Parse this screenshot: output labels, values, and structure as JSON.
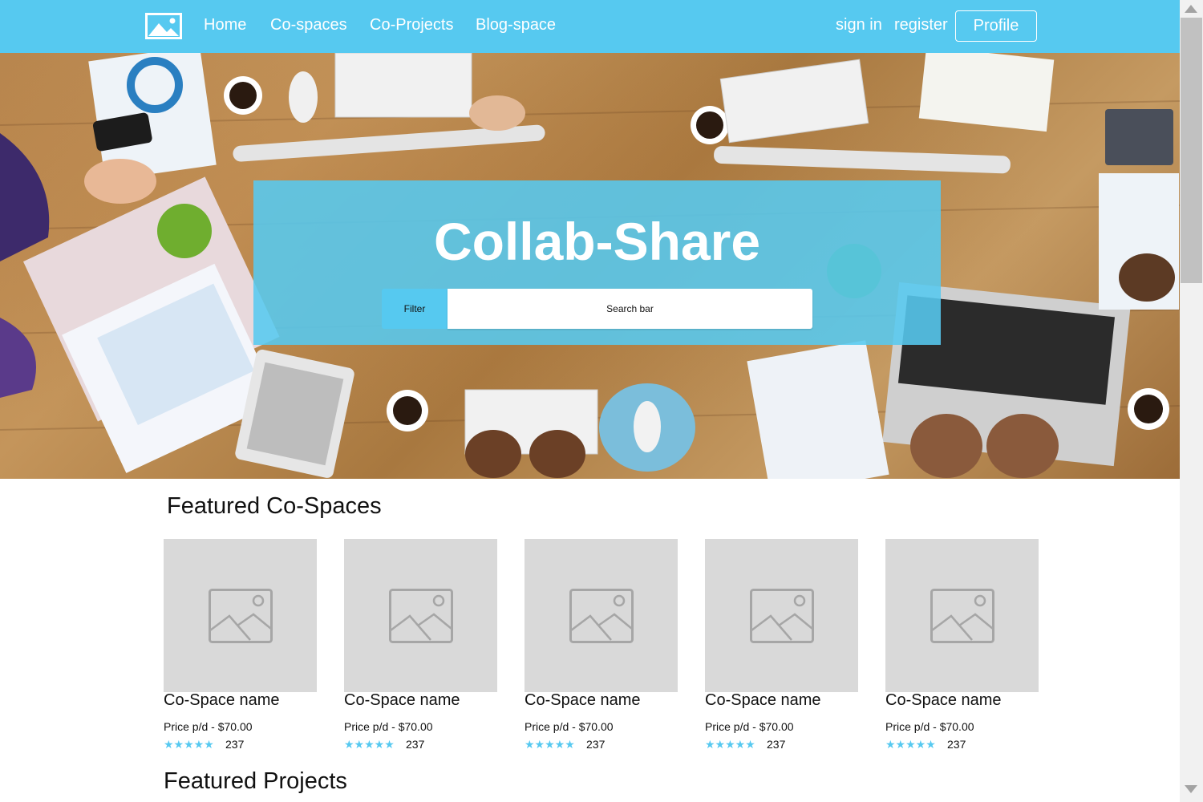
{
  "nav": {
    "logo_icon": "image-icon",
    "links": [
      "Home",
      "Co-spaces",
      "Co-Projects",
      "Blog-space"
    ],
    "sign_in": "sign in",
    "register": "register",
    "profile": "Profile"
  },
  "hero": {
    "title": "Collab-Share",
    "filter_label": "Filter",
    "search_placeholder": "Search bar"
  },
  "featured_spaces": {
    "title": "Featured Co-Spaces",
    "cards": [
      {
        "name": "Co-Space name",
        "price": "Price p/d - $70.00",
        "stars": "★★★★★",
        "count": "237"
      },
      {
        "name": "Co-Space name",
        "price": "Price p/d - $70.00",
        "stars": "★★★★★",
        "count": "237"
      },
      {
        "name": "Co-Space name",
        "price": "Price p/d - $70.00",
        "stars": "★★★★★",
        "count": "237"
      },
      {
        "name": "Co-Space name",
        "price": "Price p/d - $70.00",
        "stars": "★★★★★",
        "count": "237"
      },
      {
        "name": "Co-Space name",
        "price": "Price p/d - $70.00",
        "stars": "★★★★★",
        "count": "237"
      }
    ]
  },
  "featured_projects": {
    "title": "Featured Projects"
  },
  "colors": {
    "accent": "#56c9f0",
    "placeholder_bg": "#d9d9d9"
  }
}
